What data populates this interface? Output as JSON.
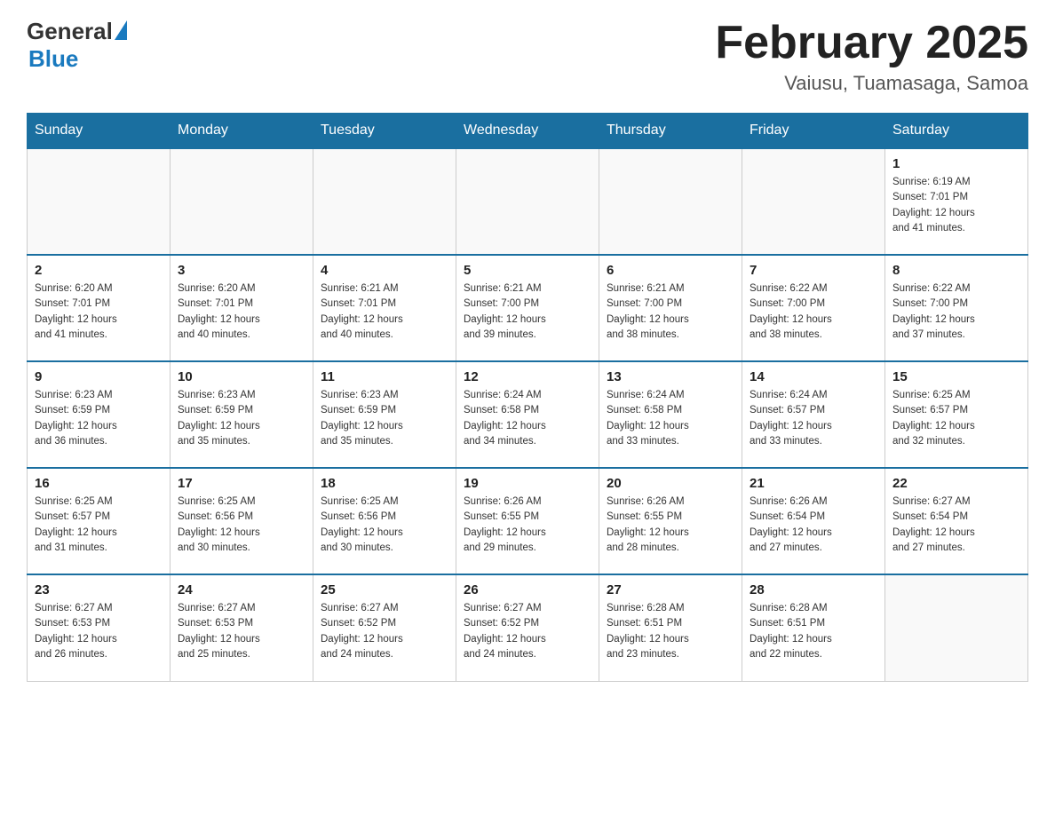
{
  "header": {
    "logo_general": "General",
    "logo_blue": "Blue",
    "month_title": "February 2025",
    "location": "Vaiusu, Tuamasaga, Samoa"
  },
  "weekdays": [
    "Sunday",
    "Monday",
    "Tuesday",
    "Wednesday",
    "Thursday",
    "Friday",
    "Saturday"
  ],
  "weeks": [
    [
      {
        "day": "",
        "info": ""
      },
      {
        "day": "",
        "info": ""
      },
      {
        "day": "",
        "info": ""
      },
      {
        "day": "",
        "info": ""
      },
      {
        "day": "",
        "info": ""
      },
      {
        "day": "",
        "info": ""
      },
      {
        "day": "1",
        "info": "Sunrise: 6:19 AM\nSunset: 7:01 PM\nDaylight: 12 hours\nand 41 minutes."
      }
    ],
    [
      {
        "day": "2",
        "info": "Sunrise: 6:20 AM\nSunset: 7:01 PM\nDaylight: 12 hours\nand 41 minutes."
      },
      {
        "day": "3",
        "info": "Sunrise: 6:20 AM\nSunset: 7:01 PM\nDaylight: 12 hours\nand 40 minutes."
      },
      {
        "day": "4",
        "info": "Sunrise: 6:21 AM\nSunset: 7:01 PM\nDaylight: 12 hours\nand 40 minutes."
      },
      {
        "day": "5",
        "info": "Sunrise: 6:21 AM\nSunset: 7:00 PM\nDaylight: 12 hours\nand 39 minutes."
      },
      {
        "day": "6",
        "info": "Sunrise: 6:21 AM\nSunset: 7:00 PM\nDaylight: 12 hours\nand 38 minutes."
      },
      {
        "day": "7",
        "info": "Sunrise: 6:22 AM\nSunset: 7:00 PM\nDaylight: 12 hours\nand 38 minutes."
      },
      {
        "day": "8",
        "info": "Sunrise: 6:22 AM\nSunset: 7:00 PM\nDaylight: 12 hours\nand 37 minutes."
      }
    ],
    [
      {
        "day": "9",
        "info": "Sunrise: 6:23 AM\nSunset: 6:59 PM\nDaylight: 12 hours\nand 36 minutes."
      },
      {
        "day": "10",
        "info": "Sunrise: 6:23 AM\nSunset: 6:59 PM\nDaylight: 12 hours\nand 35 minutes."
      },
      {
        "day": "11",
        "info": "Sunrise: 6:23 AM\nSunset: 6:59 PM\nDaylight: 12 hours\nand 35 minutes."
      },
      {
        "day": "12",
        "info": "Sunrise: 6:24 AM\nSunset: 6:58 PM\nDaylight: 12 hours\nand 34 minutes."
      },
      {
        "day": "13",
        "info": "Sunrise: 6:24 AM\nSunset: 6:58 PM\nDaylight: 12 hours\nand 33 minutes."
      },
      {
        "day": "14",
        "info": "Sunrise: 6:24 AM\nSunset: 6:57 PM\nDaylight: 12 hours\nand 33 minutes."
      },
      {
        "day": "15",
        "info": "Sunrise: 6:25 AM\nSunset: 6:57 PM\nDaylight: 12 hours\nand 32 minutes."
      }
    ],
    [
      {
        "day": "16",
        "info": "Sunrise: 6:25 AM\nSunset: 6:57 PM\nDaylight: 12 hours\nand 31 minutes."
      },
      {
        "day": "17",
        "info": "Sunrise: 6:25 AM\nSunset: 6:56 PM\nDaylight: 12 hours\nand 30 minutes."
      },
      {
        "day": "18",
        "info": "Sunrise: 6:25 AM\nSunset: 6:56 PM\nDaylight: 12 hours\nand 30 minutes."
      },
      {
        "day": "19",
        "info": "Sunrise: 6:26 AM\nSunset: 6:55 PM\nDaylight: 12 hours\nand 29 minutes."
      },
      {
        "day": "20",
        "info": "Sunrise: 6:26 AM\nSunset: 6:55 PM\nDaylight: 12 hours\nand 28 minutes."
      },
      {
        "day": "21",
        "info": "Sunrise: 6:26 AM\nSunset: 6:54 PM\nDaylight: 12 hours\nand 27 minutes."
      },
      {
        "day": "22",
        "info": "Sunrise: 6:27 AM\nSunset: 6:54 PM\nDaylight: 12 hours\nand 27 minutes."
      }
    ],
    [
      {
        "day": "23",
        "info": "Sunrise: 6:27 AM\nSunset: 6:53 PM\nDaylight: 12 hours\nand 26 minutes."
      },
      {
        "day": "24",
        "info": "Sunrise: 6:27 AM\nSunset: 6:53 PM\nDaylight: 12 hours\nand 25 minutes."
      },
      {
        "day": "25",
        "info": "Sunrise: 6:27 AM\nSunset: 6:52 PM\nDaylight: 12 hours\nand 24 minutes."
      },
      {
        "day": "26",
        "info": "Sunrise: 6:27 AM\nSunset: 6:52 PM\nDaylight: 12 hours\nand 24 minutes."
      },
      {
        "day": "27",
        "info": "Sunrise: 6:28 AM\nSunset: 6:51 PM\nDaylight: 12 hours\nand 23 minutes."
      },
      {
        "day": "28",
        "info": "Sunrise: 6:28 AM\nSunset: 6:51 PM\nDaylight: 12 hours\nand 22 minutes."
      },
      {
        "day": "",
        "info": ""
      }
    ]
  ]
}
